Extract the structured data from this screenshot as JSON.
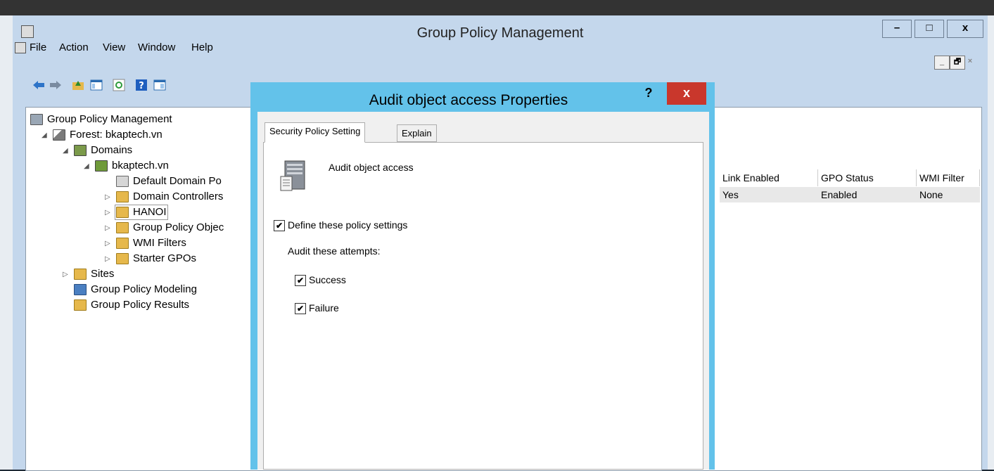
{
  "window": {
    "title": "Group Policy Management",
    "controls": {
      "minimize": "–",
      "maximize": "□",
      "close": "x"
    }
  },
  "menubar": {
    "items": [
      "File",
      "Action",
      "View",
      "Window",
      "Help"
    ],
    "mdi_controls": {
      "minimize": "_",
      "restore": "🗗",
      "close": "×"
    }
  },
  "toolbar": {
    "buttons": [
      "back-arrow-icon",
      "forward-arrow-icon",
      "up-folder-icon",
      "show-hide-tree-icon",
      "refresh-icon",
      "help-icon",
      "properties-icon"
    ]
  },
  "tree": {
    "items": [
      {
        "label": "Group Policy Management",
        "icon": "gpm-console-icon"
      },
      {
        "label": "Forest: bkaptech.vn",
        "icon": "forest-icon"
      },
      {
        "label": "Domains",
        "icon": "domains-icon"
      },
      {
        "label": "bkaptech.vn",
        "icon": "domain-icon"
      },
      {
        "label": "Default Domain Po",
        "icon": "gpo-link-icon"
      },
      {
        "label": "Domain Controllers",
        "icon": "ou-folder-icon"
      },
      {
        "label": "HANOI",
        "icon": "ou-folder-icon"
      },
      {
        "label": "Group Policy Objec",
        "icon": "gpo-folder-icon"
      },
      {
        "label": "WMI Filters",
        "icon": "wmi-folder-icon"
      },
      {
        "label": "Starter GPOs",
        "icon": "starter-folder-icon"
      },
      {
        "label": "Sites",
        "icon": "sites-icon"
      },
      {
        "label": "Group Policy Modeling",
        "icon": "modeling-icon"
      },
      {
        "label": "Group Policy Results",
        "icon": "results-icon"
      }
    ]
  },
  "linked_table": {
    "headers": [
      "Link Enabled",
      "GPO Status",
      "WMI Filter"
    ],
    "rows": [
      [
        "Yes",
        "Enabled",
        "None"
      ]
    ]
  },
  "dialog": {
    "title": "Audit object access Properties",
    "help": "?",
    "close": "x",
    "tabs": [
      "Security Policy Setting",
      "Explain"
    ],
    "policy_name": "Audit object access",
    "define_label": "Define these policy settings",
    "define_checked": true,
    "attempts_label": "Audit these attempts:",
    "success_label": "Success",
    "success_checked": true,
    "failure_label": "Failure",
    "failure_checked": true
  }
}
